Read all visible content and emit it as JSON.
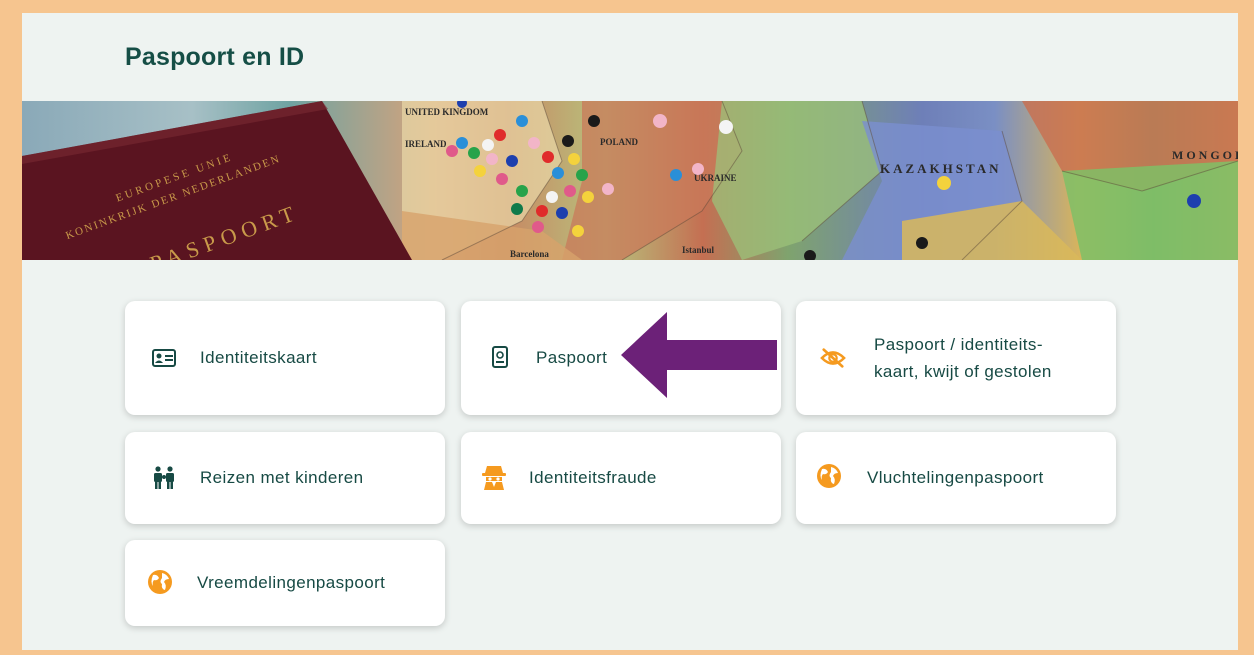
{
  "page": {
    "title": "Paspoort en ID"
  },
  "banner": {
    "passport_text_line1": "EUROPESE UNIE",
    "passport_text_line2": "KONINKRIJK DER NEDERLANDEN",
    "passport_word": "PASPOORT",
    "map_labels": [
      "UNITED KINGDOM",
      "IRELAND",
      "POLAND",
      "UKRAINE",
      "KAZAKHSTAN",
      "MONGOL",
      "Barcelona",
      "Istanbul"
    ]
  },
  "cards": [
    {
      "label": "Identiteitskaart",
      "icon": "id-card-icon"
    },
    {
      "label": "Paspoort",
      "icon": "passport-icon"
    },
    {
      "label_line1": "Paspoort / identiteits-",
      "label_line2": "kaart, kwijt of gestolen",
      "icon": "eye-slash-icon"
    },
    {
      "label": "Reizen met kinderen",
      "icon": "family-icon"
    },
    {
      "label": "Identiteitsfraude",
      "icon": "spy-icon"
    },
    {
      "label": "Vluchtelingenpaspoort",
      "icon": "globe-icon"
    },
    {
      "label": "Vreemdelingenpaspoort",
      "icon": "globe-icon"
    }
  ],
  "colors": {
    "accent": "#f59a1f",
    "text": "#174a44",
    "title": "#154e46",
    "arrow": "#6c2178",
    "frame": "#f6c58f"
  }
}
